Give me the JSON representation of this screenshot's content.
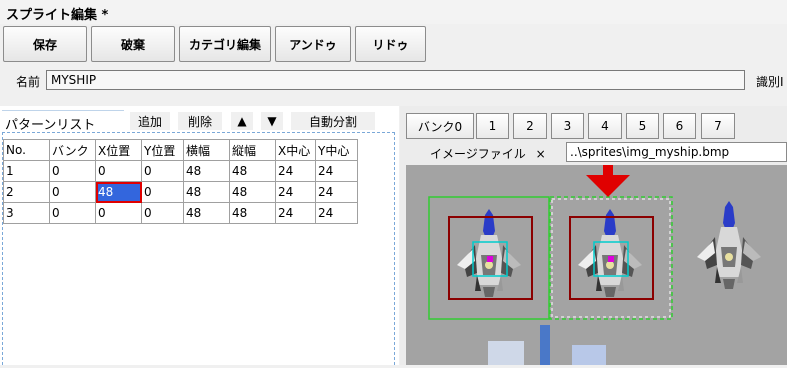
{
  "window": {
    "title": "スプライト編集 *"
  },
  "toolbar": {
    "save": "保存",
    "discard": "破棄",
    "category_edit": "カテゴリ編集",
    "undo": "アンドゥ",
    "redo": "リドゥ"
  },
  "name_row": {
    "label": "名前",
    "value": "MYSHIP",
    "id_label": "識別I"
  },
  "pattern_list": {
    "title": "パターンリスト",
    "add": "追加",
    "delete": "削除",
    "up": "▲",
    "down": "▼",
    "auto_split": "自動分割",
    "columns": [
      "No.",
      "バンク",
      "X位置",
      "Y位置",
      "横幅",
      "縦幅",
      "X中心",
      "Y中心"
    ],
    "rows": [
      [
        "1",
        "0",
        "0",
        "0",
        "48",
        "48",
        "24",
        "24"
      ],
      [
        "2",
        "0",
        "48",
        "0",
        "48",
        "48",
        "24",
        "24"
      ],
      [
        "3",
        "0",
        "0",
        "0",
        "48",
        "48",
        "24",
        "24"
      ]
    ]
  },
  "bank_tabs": [
    "バンク0",
    "1",
    "2",
    "3",
    "4",
    "5",
    "6",
    "7"
  ],
  "image": {
    "label": "イメージファイル",
    "clear": "×",
    "path": "..\\sprites\\img_myship.bmp"
  },
  "colors": {
    "selection_fill": "#3366dd",
    "selection_border": "#e00000",
    "annotation_arrow": "#e00000",
    "frame_green": "#33cc33",
    "frame_red": "#8b0000",
    "center_cyan": "#00cccc",
    "center_magenta": "#dd00dd"
  }
}
